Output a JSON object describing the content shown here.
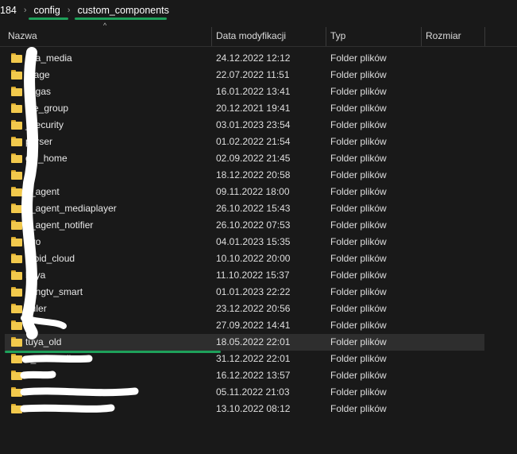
{
  "breadcrumb": {
    "items": [
      "184",
      "config",
      "custom_components"
    ],
    "separator": "›"
  },
  "columns": {
    "name": "Nazwa",
    "modified": "Data modyfikacji",
    "type": "Typ",
    "size": "Rozmiar"
  },
  "colors": {
    "background": "#191919",
    "folder": "#f2c94c",
    "annotation": "#1ea05a",
    "selected_row": "#2e2e2e"
  },
  "files": [
    {
      "name": "exa_media",
      "modified": "24.12.2022 12:12",
      "type": "Folder plików"
    },
    {
      "name": "erage",
      "modified": "22.07.2022 11:51",
      "type": "Folder plików"
    },
    {
      "name": "chgas",
      "modified": "16.01.2022 13:41",
      "type": "Folder plików"
    },
    {
      "name": "ate_group",
      "modified": "20.12.2021 19:41",
      "type": "Folder plików"
    },
    {
      "name": "_security",
      "modified": "03.01.2023 23:54",
      "type": "Folder plików"
    },
    {
      "name": "parser",
      "modified": "01.02.2022 21:54",
      "type": "Folder plików"
    },
    {
      "name": "gle_home",
      "modified": "02.09.2022 21:45",
      "type": "Folder plików"
    },
    {
      "name": "s",
      "modified": "18.12.2022 20:58",
      "type": "Folder plików"
    },
    {
      "name": "s_agent",
      "modified": "09.11.2022 18:00",
      "type": "Folder plików"
    },
    {
      "name": "s_agent_mediaplayer",
      "modified": "26.10.2022 15:43",
      "type": "Folder plików"
    },
    {
      "name": "s_agent_notifier",
      "modified": "26.10.2022 07:53",
      "type": "Folder plików"
    },
    {
      "name": "uvo",
      "modified": "04.01.2023 15:35",
      "type": "Folder plików"
    },
    {
      "name": "droid_cloud",
      "modified": "10.10.2022 20:00",
      "type": "Folder plików"
    },
    {
      "name": "ltuya",
      "modified": "11.10.2022 15:37",
      "type": "Folder plików"
    },
    {
      "name": "sungtv_smart",
      "modified": "01.01.2023 22:22",
      "type": "Folder plików"
    },
    {
      "name": "duler",
      "modified": "23.12.2022 20:56",
      "type": "Folder plików"
    },
    {
      "name": "",
      "modified": "27.09.2022 14:41",
      "type": "Folder plików"
    },
    {
      "name": "tuya_old",
      "modified": "18.05.2022 22:01",
      "type": "Folder plików",
      "selected": true
    },
    {
      "name": "e_minimalist",
      "modified": "31.12.2022 22:01",
      "type": "Folder plików"
    },
    {
      "name": "",
      "modified": "16.12.2022 13:57",
      "type": "Folder plików"
    },
    {
      "name": "r",
      "modified": "05.11.2022 21:03",
      "type": "Folder plików"
    },
    {
      "name": "",
      "modified": "13.10.2022 08:12",
      "type": "Folder plików"
    }
  ]
}
